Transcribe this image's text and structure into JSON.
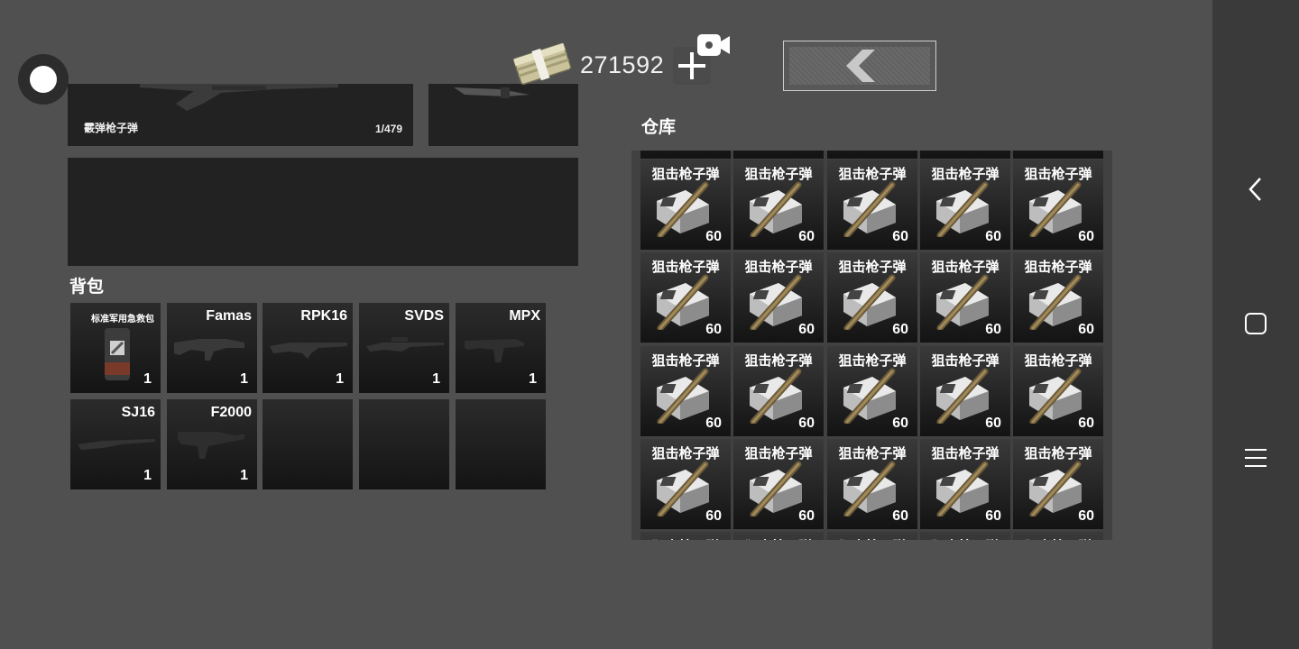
{
  "header": {
    "money": "271592"
  },
  "equipment": {
    "ammo_label": "霰弹枪子弹",
    "ammo_count": "1/479"
  },
  "backpack": {
    "title": "背包",
    "items": [
      {
        "name": "标准军用急救包",
        "qty": "1",
        "icon": "medkit-icon"
      },
      {
        "name": "Famas",
        "qty": "1",
        "icon": "rifle-icon"
      },
      {
        "name": "RPK16",
        "qty": "1",
        "icon": "rifle-icon"
      },
      {
        "name": "SVDS",
        "qty": "1",
        "icon": "sniper-rifle-icon"
      },
      {
        "name": "MPX",
        "qty": "1",
        "icon": "smg-icon"
      },
      {
        "name": "SJ16",
        "qty": "1",
        "icon": "rifle-icon"
      },
      {
        "name": "F2000",
        "qty": "1",
        "icon": "rifle-icon"
      },
      {
        "name": "",
        "qty": ""
      },
      {
        "name": "",
        "qty": ""
      },
      {
        "name": "",
        "qty": ""
      }
    ]
  },
  "warehouse": {
    "title": "仓库",
    "item_name": "狙击枪子弹",
    "item_qty": "60",
    "item_icon": "sniper-ammo-icon"
  },
  "colors": {
    "background": "#505050",
    "slot": "#222222",
    "nav_bar": "#3a3a3a"
  }
}
